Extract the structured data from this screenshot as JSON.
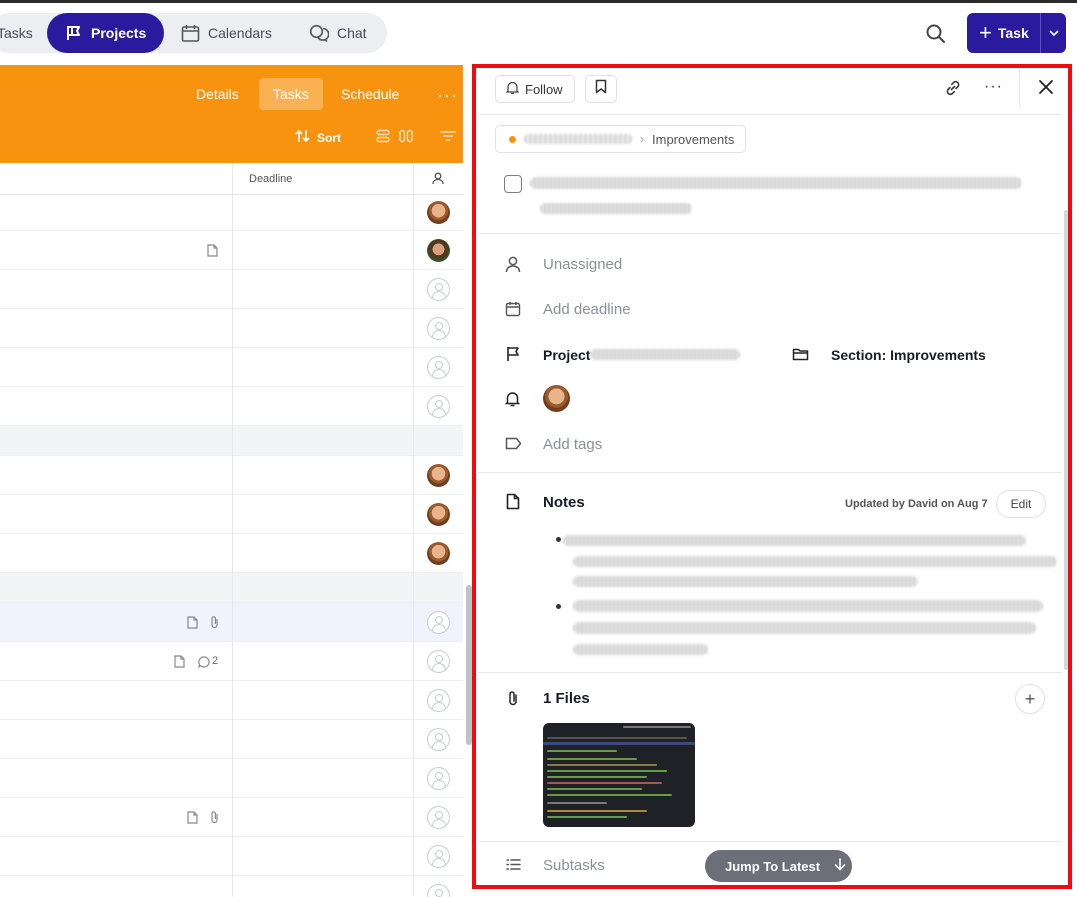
{
  "nav": {
    "items": [
      {
        "label": "Tasks",
        "icon": "check-icon"
      },
      {
        "label": "Projects",
        "icon": "flag-icon",
        "active": true
      },
      {
        "label": "Calendars",
        "icon": "calendar-icon"
      },
      {
        "label": "Chat",
        "icon": "chat-icon"
      }
    ],
    "new_task_label": "Task",
    "accent": "#2a1a9e"
  },
  "project": {
    "color": "#f7930f",
    "tabs": [
      {
        "label": "Details"
      },
      {
        "label": "Tasks",
        "active": true
      },
      {
        "label": "Schedule"
      }
    ],
    "sort_label": "Sort",
    "columns": {
      "deadline": "Deadline"
    },
    "comment_count": "2"
  },
  "task_detail": {
    "follow_label": "Follow",
    "breadcrumb_section": "Improvements",
    "assignee_placeholder": "Unassigned",
    "deadline_placeholder": "Add deadline",
    "project_label": "Project",
    "section_label": "Section: Improvements",
    "tags_placeholder": "Add tags",
    "notes_title": "Notes",
    "notes_updated": "Updated by David on Aug 7",
    "edit_label": "Edit",
    "files_title": "1 Files",
    "subtasks_label": "Subtasks",
    "jump_label": "Jump To Latest"
  }
}
